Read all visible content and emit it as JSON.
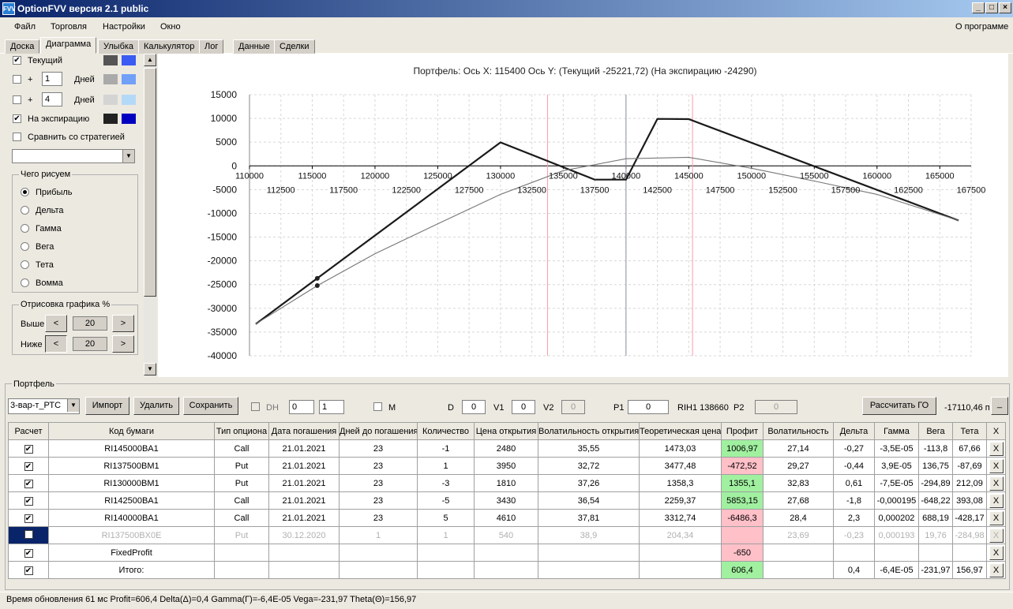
{
  "window": {
    "title": "OptionFVV версия 2.1 public",
    "logo": "FVV"
  },
  "menu": {
    "items": [
      "Файл",
      "Торговля",
      "Настройки",
      "Окно"
    ],
    "about": "О программе"
  },
  "tabs": [
    "Доска",
    "Диаграмма",
    "Улыбка",
    "Калькулятор",
    "Лог",
    "Данные",
    "Сделки"
  ],
  "left": {
    "current_label": "Текущий",
    "plus1_label": "+",
    "plus1_value": "1",
    "days_label": "Дней",
    "plus2_label": "+",
    "plus2_value": "4",
    "expiry_label": "На экспирацию",
    "compare_label": "Сравнить со стратегией",
    "colors": {
      "current": [
        "#555555",
        "#3a5cf2"
      ],
      "p1": [
        "#aaaaaa",
        "#70a0f8"
      ],
      "p2": [
        "#d4d4d4",
        "#b4d8f8"
      ],
      "expiry": [
        "#222222",
        "#0000c0"
      ]
    },
    "what_group": "Чего рисуем",
    "radios": [
      "Прибыль",
      "Дельта",
      "Гамма",
      "Вега",
      "Тета",
      "Вомма"
    ],
    "draw_group": "Отрисовка графика %",
    "above_label": "Выше",
    "below_label": "Ниже",
    "above_value": "20",
    "below_value": "20",
    "lt": "<",
    "gt": ">"
  },
  "chart_data": {
    "type": "line",
    "title": "Портфель:  Ось X:  115400  Ось Y:   (Текущий  -25221,72)   (На экспирацию  -24290)",
    "xlim": [
      110000,
      167500
    ],
    "ylim": [
      -40000,
      15000
    ],
    "yticks": [
      "15000",
      "10000",
      "5000",
      "0",
      "-5000",
      "-10000",
      "-15000",
      "-20000",
      "-25000",
      "-30000",
      "-35000",
      "-40000"
    ],
    "xticks_top": [
      "110000",
      "115000",
      "120000",
      "125000",
      "130000",
      "135000",
      "140000",
      "145000",
      "150000",
      "155000",
      "160000",
      "165000"
    ],
    "xticks_bottom": [
      "112500",
      "117500",
      "122500",
      "127500",
      "132500",
      "137500",
      "142500",
      "147500",
      "152500",
      "157500",
      "162500",
      "167500"
    ],
    "vlines_red": [
      133750,
      145300
    ],
    "vline_gray": 140000,
    "marker_x": 115400,
    "series": [
      {
        "x": [
          110500,
          130000,
          137500,
          140000,
          142500,
          145000,
          166500
        ],
        "y": [
          -33300,
          4950,
          -2900,
          -2900,
          9900,
          9850,
          -11500
        ]
      },
      {
        "x": [
          110500,
          115400,
          120000,
          125000,
          130000,
          135000,
          140000,
          145000,
          150000,
          155000,
          160000,
          166500
        ],
        "y": [
          -33300,
          -25221,
          -18500,
          -12200,
          -6000,
          -1000,
          1500,
          1800,
          -500,
          -3200,
          -6000,
          -11500
        ]
      }
    ]
  },
  "portfolio": {
    "group": "Портфель",
    "combo": "3-вар-т_РТС",
    "import": "Импорт",
    "delete": "Удалить",
    "save": "Сохранить",
    "dh_label": "DH",
    "dh1": "0",
    "dh2": "1",
    "m_label": "M",
    "d_label": "D",
    "d_value": "0",
    "v1_label": "V1",
    "v1_value": "0",
    "v2_label": "V2",
    "v2_value": "0",
    "p1_label": "P1",
    "p1_value": "0",
    "rih_label": "RIH1 138660",
    "p2_label": "P2",
    "p2_value": "0",
    "calc": "Рассчитать ГО",
    "go_value": "-17110,46 п",
    "go_btn": "_"
  },
  "table": {
    "headers": [
      "Расчет",
      "Код бумаги",
      "Тип опциона",
      "Дата погашения",
      "Дней до погашения",
      "Количество",
      "Цена открытия",
      "Волатильность открытия",
      "Теоретическая цена",
      "Профит",
      "Волатильность",
      "Дельта",
      "Гамма",
      "Вега",
      "Тета",
      "X"
    ],
    "rows": [
      {
        "dim": false,
        "sel": false,
        "check": "✔",
        "cells": [
          "RI145000BA1",
          "Call",
          "21.01.2021",
          "23",
          "-1",
          "2480",
          "35,55",
          "1473,03",
          "1006,97",
          "27,14",
          "-0,27",
          "-3,5E-05",
          "-113,8",
          "67,66"
        ],
        "pcls": "green"
      },
      {
        "dim": false,
        "sel": false,
        "check": "✔",
        "cells": [
          "RI137500BM1",
          "Put",
          "21.01.2021",
          "23",
          "1",
          "3950",
          "32,72",
          "3477,48",
          "-472,52",
          "29,27",
          "-0,44",
          "3,9E-05",
          "136,75",
          "-87,69"
        ],
        "pcls": "pink"
      },
      {
        "dim": false,
        "sel": false,
        "check": "✔",
        "cells": [
          "RI130000BM1",
          "Put",
          "21.01.2021",
          "23",
          "-3",
          "1810",
          "37,26",
          "1358,3",
          "1355,1",
          "32,83",
          "0,61",
          "-7,5E-05",
          "-294,89",
          "212,09"
        ],
        "pcls": "green"
      },
      {
        "dim": false,
        "sel": false,
        "check": "✔",
        "cells": [
          "RI142500BA1",
          "Call",
          "21.01.2021",
          "23",
          "-5",
          "3430",
          "36,54",
          "2259,37",
          "5853,15",
          "27,68",
          "-1,8",
          "-0,000195",
          "-648,22",
          "393,08"
        ],
        "pcls": "green"
      },
      {
        "dim": false,
        "sel": false,
        "check": "✔",
        "cells": [
          "RI140000BA1",
          "Call",
          "21.01.2021",
          "23",
          "5",
          "4610",
          "37,81",
          "3312,74",
          "-6486,3",
          "28,4",
          "2,3",
          "0,000202",
          "688,19",
          "-428,17"
        ],
        "pcls": "pink"
      },
      {
        "dim": true,
        "sel": true,
        "check": "",
        "cells": [
          "RI137500BX0E",
          "Put",
          "30.12.2020",
          "1",
          "1",
          "540",
          "38,9",
          "204,34",
          "",
          "23,69",
          "-0,23",
          "0,000193",
          "19,76",
          "-284,98"
        ],
        "pcls": "pink"
      },
      {
        "dim": false,
        "sel": false,
        "check": "✔",
        "cells": [
          "FixedProfit",
          "",
          "",
          "",
          "",
          "",
          "",
          "",
          "-650",
          "",
          "",
          "",
          "",
          ""
        ],
        "pcls": "pink"
      },
      {
        "dim": false,
        "sel": false,
        "check": "✔",
        "cells": [
          "Итого:",
          "",
          "",
          "",
          "",
          "",
          "",
          "",
          "606,4",
          "",
          "0,4",
          "-6,4E-05",
          "-231,97",
          "156,97"
        ],
        "pcls": "green"
      }
    ]
  },
  "status": "Время обновления 61 мс  Profit=606,4 Delta(Δ)=0,4 Gamma(Γ)=-6,4E-05 Vega=-231,97 Theta(Θ)=156,97"
}
